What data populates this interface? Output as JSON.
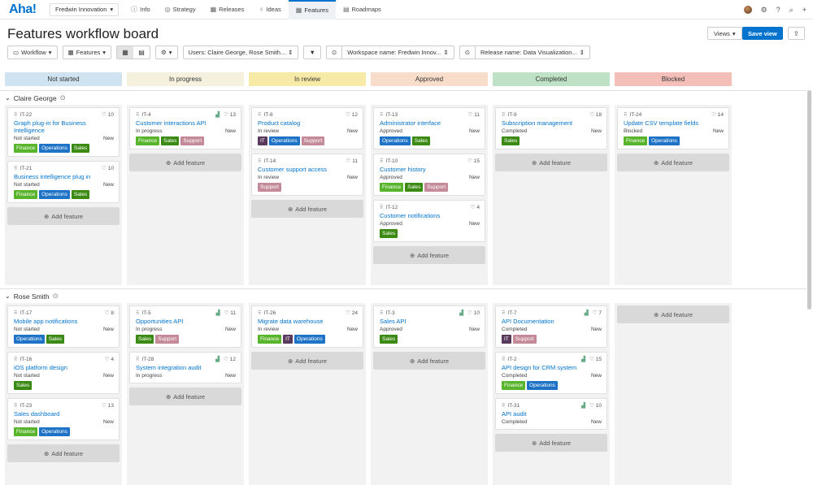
{
  "app": {
    "logo": "Aha!",
    "workspace": "Fredwin Innovation"
  },
  "nav": [
    {
      "label": "Info",
      "icon": "ⓘ"
    },
    {
      "label": "Strategy",
      "icon": "◎"
    },
    {
      "label": "Releases",
      "icon": "▦"
    },
    {
      "label": "Ideas",
      "icon": "♀"
    },
    {
      "label": "Features",
      "icon": "▦"
    },
    {
      "label": "Roadmaps",
      "icon": "▤"
    }
  ],
  "page": {
    "title": "Features workflow board",
    "views_label": "Views",
    "save_view_label": "Save view"
  },
  "filters": {
    "workflow": "Workflow",
    "features": "Features",
    "users": "Users: Claire George, Rose Smith...",
    "workspace": "Workspace name: Fredwin Innov...",
    "release": "Release name: Data Visualization..."
  },
  "colors": {
    "finance": "#58b42a",
    "operations": "#1e73c6",
    "sales": "#3b8a14",
    "support": "#c48a9a",
    "it": "#5a3a5c"
  },
  "statuses": [
    {
      "label": "Not started",
      "color": "#cfe3f0"
    },
    {
      "label": "In progress",
      "color": "#f5f1de"
    },
    {
      "label": "In review",
      "color": "#f7eaa7"
    },
    {
      "label": "Approved",
      "color": "#f8ddcb"
    },
    {
      "label": "Completed",
      "color": "#bfe2c6"
    },
    {
      "label": "Blocked",
      "color": "#f4bfb9"
    }
  ],
  "add_label": "Add feature",
  "lanes": [
    {
      "name": "Claire George",
      "columns": [
        [
          {
            "id": "IT-22",
            "name": "Graph plug-in for Business Intelligence",
            "status": "Not started",
            "score": "New",
            "votes": "10",
            "chart": false,
            "tags": [
              "Finance",
              "Operations",
              "Sales"
            ]
          },
          {
            "id": "IT-21",
            "name": "Business intelligence plug in",
            "status": "Not started",
            "score": "New",
            "votes": "10",
            "chart": false,
            "tags": [
              "Finance",
              "Operations",
              "Sales"
            ]
          }
        ],
        [
          {
            "id": "IT-4",
            "name": "Customer interactions API",
            "status": "In progress",
            "score": "New",
            "votes": "13",
            "chart": true,
            "tags": [
              "Finance",
              "Sales",
              "Support"
            ]
          }
        ],
        [
          {
            "id": "IT-8",
            "name": "Product catalog",
            "status": "In review",
            "score": "New",
            "votes": "12",
            "chart": false,
            "tags": [
              "IT",
              "Operations",
              "Support"
            ]
          },
          {
            "id": "IT-14",
            "name": "Customer support access",
            "status": "In review",
            "score": "New",
            "votes": "11",
            "chart": false,
            "tags": [
              "Support"
            ]
          }
        ],
        [
          {
            "id": "IT-13",
            "name": "Administrator interface",
            "status": "Approved",
            "score": "New",
            "votes": "11",
            "chart": false,
            "tags": [
              "Operations",
              "Sales"
            ]
          },
          {
            "id": "IT-10",
            "name": "Customer history",
            "status": "Approved",
            "score": "New",
            "votes": "15",
            "chart": false,
            "tags": [
              "Finance",
              "Sales",
              "Support"
            ]
          },
          {
            "id": "IT-12",
            "name": "Customer notifications",
            "status": "Approved",
            "score": "New",
            "votes": "4",
            "chart": false,
            "tags": [
              "Sales"
            ]
          }
        ],
        [
          {
            "id": "IT-9",
            "name": "Subscription management",
            "status": "Completed",
            "score": "New",
            "votes": "18",
            "chart": false,
            "tags": [
              "Sales"
            ]
          }
        ],
        [
          {
            "id": "IT-24",
            "name": "Update CSV template fields",
            "status": "Blocked",
            "score": "New",
            "votes": "14",
            "chart": false,
            "tags": [
              "Finance",
              "Operations"
            ]
          }
        ]
      ]
    },
    {
      "name": "Rose Smith",
      "columns": [
        [
          {
            "id": "IT-17",
            "name": "Mobile app notifications",
            "status": "Not started",
            "score": "New",
            "votes": "8",
            "chart": false,
            "tags": [
              "Operations",
              "Sales"
            ]
          },
          {
            "id": "IT-16",
            "name": "iOS platform design",
            "status": "Not started",
            "score": "New",
            "votes": "4",
            "chart": false,
            "tags": [
              "Sales"
            ]
          },
          {
            "id": "IT-23",
            "name": "Sales dashboard",
            "status": "Not started",
            "score": "New",
            "votes": "13",
            "chart": false,
            "tags": [
              "Finance",
              "Operations"
            ]
          }
        ],
        [
          {
            "id": "IT-5",
            "name": "Opportunities API",
            "status": "In progress",
            "score": "New",
            "votes": "11",
            "chart": true,
            "tags": [
              "Sales",
              "Support"
            ]
          },
          {
            "id": "IT-28",
            "name": "System integration audit",
            "status": "In progress",
            "score": "New",
            "votes": "12",
            "chart": true,
            "tags": []
          }
        ],
        [
          {
            "id": "IT-26",
            "name": "Migrate data warehouse",
            "status": "In review",
            "score": "New",
            "votes": "24",
            "chart": false,
            "tags": [
              "Finance",
              "IT",
              "Operations"
            ]
          }
        ],
        [
          {
            "id": "IT-3",
            "name": "Sales API",
            "status": "Approved",
            "score": "New",
            "votes": "10",
            "chart": true,
            "tags": [
              "Sales"
            ]
          }
        ],
        [
          {
            "id": "IT-7",
            "name": "API Documentation",
            "status": "Completed",
            "score": "New",
            "votes": "7",
            "chart": true,
            "tags": [
              "IT",
              "Support"
            ]
          },
          {
            "id": "IT-2",
            "name": "API design for CRM system",
            "status": "Completed",
            "score": "New",
            "votes": "15",
            "chart": true,
            "tags": [
              "Finance",
              "Operations"
            ]
          },
          {
            "id": "IT-31",
            "name": "API audit",
            "status": "Completed",
            "score": "New",
            "votes": "10",
            "chart": true,
            "tags": []
          }
        ],
        []
      ]
    }
  ]
}
